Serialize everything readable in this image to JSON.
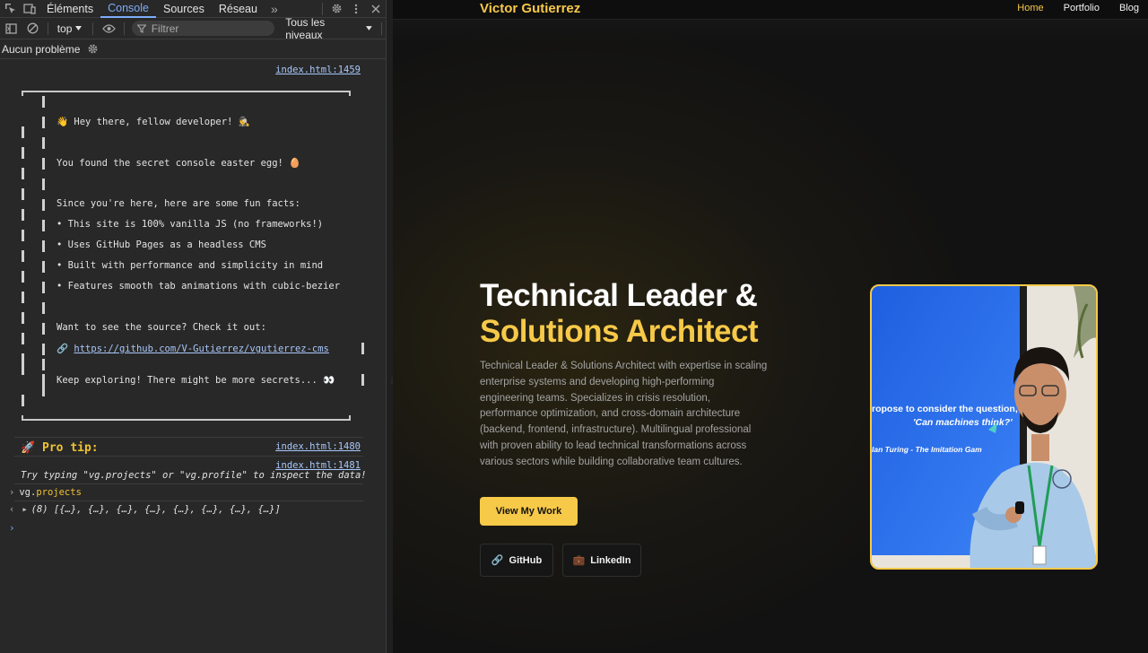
{
  "devtools": {
    "tabs": [
      "Éléments",
      "Console",
      "Sources",
      "Réseau"
    ],
    "active_tab": "Console",
    "more_tabs_glyph": "»",
    "context": "top",
    "filter_placeholder": "Filtrer",
    "levels": "Tous les niveaux",
    "issues": "Aucun problème",
    "source_links": {
      "egg": "index.html:1459",
      "tip": "index.html:1480",
      "tip_text": "index.html:1481"
    },
    "easter_egg": {
      "greeting": "👋 Hey there, fellow developer! 🕵",
      "found": "You found the secret console easter egg! 🥚",
      "facts_intro": "Since you're here, here are some fun facts:",
      "facts": [
        "• This site is 100% vanilla JS (no frameworks!)",
        "• Uses GitHub Pages as a headless CMS",
        "• Built with performance and simplicity in mind",
        "• Features smooth tab animations with cubic-bezier"
      ],
      "source_prompt": "Want to see the source? Check it out:",
      "link_icon": "🔗",
      "link": "https://github.com/V-Gutierrez/vgutierrez-cms",
      "closing": "Keep exploring! There might be more secrets... 👀"
    },
    "pro_tip": "🚀 Pro tip:",
    "tip_text": "Try typing \"vg.projects\" or \"vg.profile\" to inspect the data!",
    "command": {
      "prompt": "›",
      "object": "vg",
      "dot": ".",
      "property": "projects"
    },
    "result": {
      "arrow": "‹",
      "toggle": "▸",
      "value": "(8) [{…}, {…}, {…}, {…}, {…}, {…}, {…}, {…}]"
    },
    "input_prompt": "›"
  },
  "site": {
    "brand": "Victor Gutierrez",
    "nav": [
      "Home",
      "Portfolio",
      "Blog"
    ],
    "active_nav": "Home",
    "hero_line1": "Technical Leader &",
    "hero_line2": "Solutions Architect",
    "description": "Technical Leader & Solutions Architect with expertise in scaling enterprise systems and developing high-performing engineering teams. Specializes in crisis resolution, performance optimization, and cross-domain architecture (backend, frontend, infrastructure). Multilingual professional with proven ability to lead technical transformations across various sectors while building collaborative team cultures.",
    "cta": "View My Work",
    "github_icon": "🔗",
    "github": "GitHub",
    "linkedin_icon": "💼",
    "linkedin": "LinkedIn",
    "photo": {
      "slide_line1": "ropose to consider the question,",
      "slide_line2": "'Can machines think?'",
      "slide_line3": "lan Turing - The Imitation Gam"
    }
  },
  "colors": {
    "accent": "#f7c948",
    "devtools_bg": "#282828",
    "link_blue": "#a8c7fa"
  }
}
